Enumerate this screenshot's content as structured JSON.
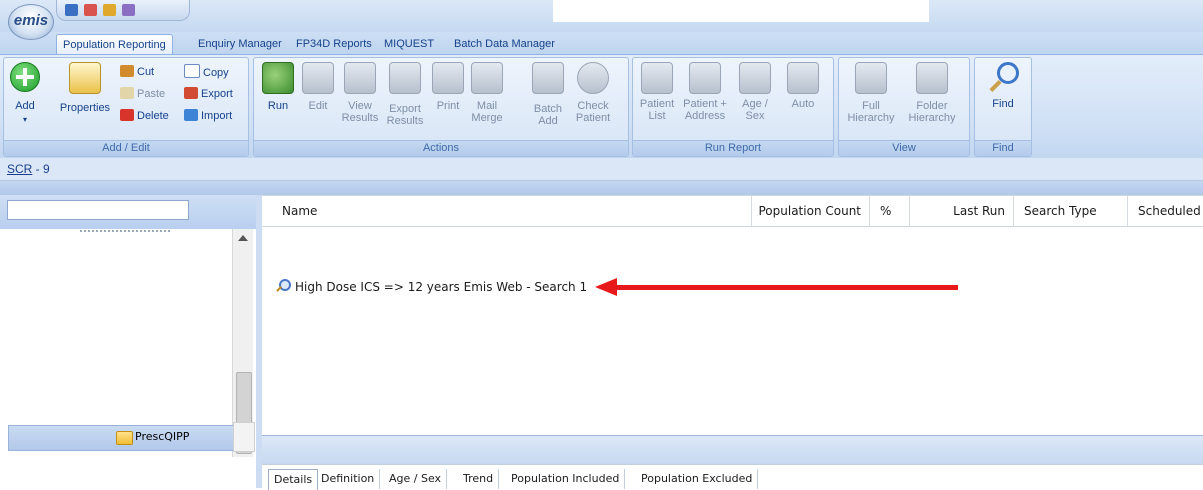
{
  "app": {
    "logo_text": "emis"
  },
  "tabs": [
    {
      "label": "Population Reporting",
      "active": true
    },
    {
      "label": "Enquiry Manager"
    },
    {
      "label": "FP34D Reports"
    },
    {
      "label": "MIQUEST"
    },
    {
      "label": "Batch Data Manager"
    }
  ],
  "ribbon": {
    "add_edit": {
      "label": "Add / Edit",
      "add": "Add",
      "properties": "Properties",
      "cut": "Cut",
      "paste": "Paste",
      "delete": "Delete",
      "copy": "Copy",
      "export": "Export",
      "import": "Import"
    },
    "actions": {
      "label": "Actions",
      "run": "Run",
      "edit": "Edit",
      "view_results": [
        "View",
        "Results"
      ],
      "export_results": [
        "Export",
        "Results"
      ],
      "print": "Print",
      "mail_merge": [
        "Mail",
        "Merge"
      ],
      "batch_add": [
        "Batch",
        "Add"
      ],
      "check_patient": [
        "Check",
        "Patient"
      ]
    },
    "run_report": {
      "label": "Run Report",
      "patient_list": [
        "Patient",
        "List"
      ],
      "patient_address": [
        "Patient +",
        "Address"
      ],
      "age_sex": [
        "Age /",
        "Sex"
      ],
      "auto": "Auto"
    },
    "view": {
      "label": "View",
      "full_hierarchy": [
        "Full",
        "Hierarchy"
      ],
      "folder_hierarchy": [
        "Folder",
        "Hierarchy"
      ]
    },
    "find": {
      "label": "Find",
      "find": "Find"
    }
  },
  "breadcrumb": {
    "link": "SCR",
    "rest": " - 9"
  },
  "tree": {
    "folder_label": "PrescQIPP"
  },
  "table": {
    "columns": [
      "Name",
      "Population Count",
      "%",
      "Last Run",
      "Search Type",
      "Scheduled"
    ],
    "rows": [
      {
        "name": "High Dose ICS => 12 years Emis Web - Search 1"
      }
    ]
  },
  "detail_tabs": [
    "Details",
    "Definition",
    "Age / Sex",
    "Trend",
    "Population Included",
    "Population Excluded"
  ],
  "annotation": {
    "arrow_color": "#e8191b"
  }
}
